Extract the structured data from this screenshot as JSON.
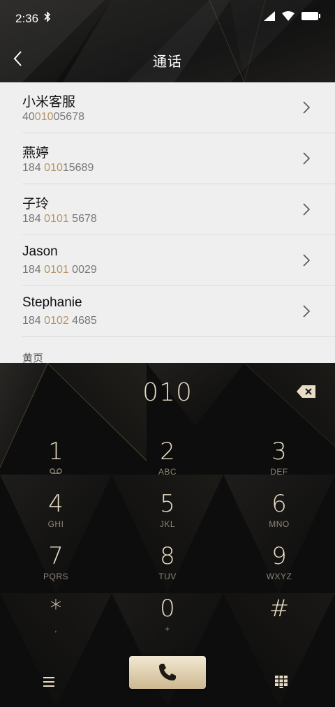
{
  "status_bar": {
    "time": "2:36"
  },
  "header": {
    "title": "通话"
  },
  "contacts": [
    {
      "name": "小米客服",
      "number_pre": "40",
      "number_match": "010",
      "number_post": "05678"
    },
    {
      "name": "燕婷",
      "number_pre": "184 ",
      "number_match": "010",
      "number_post": "15689"
    },
    {
      "name": "子玲",
      "number_pre": "184 ",
      "number_match": "0101",
      "number_post": " 5678"
    },
    {
      "name": "Jason",
      "number_pre": "184 ",
      "number_match": "0101",
      "number_post": " 0029"
    },
    {
      "name": "Stephanie",
      "number_pre": "184 ",
      "number_match": "0102",
      "number_post": " 4685"
    }
  ],
  "section_label": "黄页",
  "dialer": {
    "input": "010",
    "keys": [
      {
        "digit": "1",
        "letters": ""
      },
      {
        "digit": "2",
        "letters": "ABC"
      },
      {
        "digit": "3",
        "letters": "DEF"
      },
      {
        "digit": "4",
        "letters": "GHI"
      },
      {
        "digit": "5",
        "letters": "JKL"
      },
      {
        "digit": "6",
        "letters": "MNO"
      },
      {
        "digit": "7",
        "letters": "PQRS"
      },
      {
        "digit": "8",
        "letters": "TUV"
      },
      {
        "digit": "9",
        "letters": "WXYZ"
      },
      {
        "digit": "*",
        "letters": ","
      },
      {
        "digit": "0",
        "letters": "+"
      },
      {
        "digit": "#",
        "letters": ""
      }
    ]
  },
  "colors": {
    "gold": "#e8dcc4",
    "match_highlight": "#b39466",
    "list_bg": "#efefef"
  },
  "icons": {
    "voicemail": "voicemail-icon",
    "backspace": "backspace-icon",
    "call": "phone-icon",
    "menu": "menu-icon",
    "keypad": "keypad-icon"
  }
}
